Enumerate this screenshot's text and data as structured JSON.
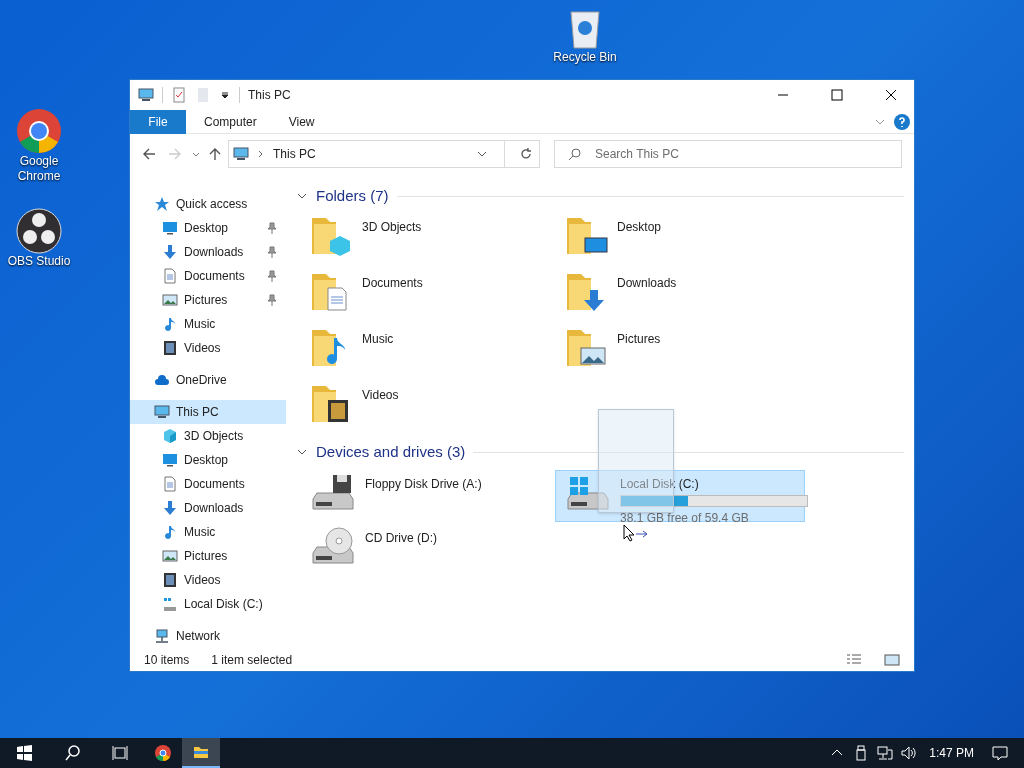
{
  "desktop_icons": [
    {
      "label": "Recycle Bin",
      "kind": "bin"
    },
    {
      "label": "Google Chrome",
      "kind": "chrome"
    },
    {
      "label": "OBS Studio",
      "kind": "obs"
    }
  ],
  "window": {
    "title": "This PC",
    "file_button": "File",
    "ribbon_tabs": [
      "Computer",
      "View"
    ],
    "address": "This PC",
    "search": {
      "placeholder": "Search This PC"
    }
  },
  "nav": [
    {
      "label": "Quick access",
      "kind": "star",
      "selected": false,
      "children": [
        {
          "label": "Desktop",
          "kind": "desktop",
          "pinned": true,
          "selected": false
        },
        {
          "label": "Downloads",
          "kind": "downloads",
          "pinned": true,
          "selected": false
        },
        {
          "label": "Documents",
          "kind": "documents",
          "pinned": true,
          "selected": false
        },
        {
          "label": "Pictures",
          "kind": "pictures",
          "pinned": true,
          "selected": false
        },
        {
          "label": "Music",
          "kind": "music",
          "pinned": false,
          "selected": false
        },
        {
          "label": "Videos",
          "kind": "videos",
          "pinned": false,
          "selected": false
        }
      ]
    },
    {
      "label": "OneDrive",
      "kind": "cloud",
      "selected": false
    },
    {
      "label": "This PC",
      "kind": "pc",
      "selected": true,
      "children": [
        {
          "label": "3D Objects",
          "kind": "objects",
          "selected": false
        },
        {
          "label": "Desktop",
          "kind": "desktop",
          "selected": false
        },
        {
          "label": "Documents",
          "kind": "documents",
          "selected": false
        },
        {
          "label": "Downloads",
          "kind": "downloads",
          "selected": false
        },
        {
          "label": "Music",
          "kind": "music",
          "selected": false
        },
        {
          "label": "Pictures",
          "kind": "pictures",
          "selected": false
        },
        {
          "label": "Videos",
          "kind": "videos",
          "selected": false
        },
        {
          "label": "Local Disk (C:)",
          "kind": "disk",
          "selected": false
        }
      ]
    },
    {
      "label": "Network",
      "kind": "network",
      "selected": false
    }
  ],
  "folders": {
    "title": "Folders (7)",
    "expanded": true,
    "items": [
      {
        "name": "3D Objects",
        "kind": "objects"
      },
      {
        "name": "Desktop",
        "kind": "desktop"
      },
      {
        "name": "Documents",
        "kind": "documents"
      },
      {
        "name": "Downloads",
        "kind": "downloads"
      },
      {
        "name": "Music",
        "kind": "music"
      },
      {
        "name": "Pictures",
        "kind": "pictures"
      },
      {
        "name": "Videos",
        "kind": "videos"
      }
    ]
  },
  "devices": {
    "title": "Devices and drives (3)",
    "expanded": true,
    "items": [
      {
        "name": "Floppy Disk Drive (A:)",
        "kind": "floppy",
        "selected": false
      },
      {
        "name": "Local Disk (C:)",
        "kind": "disk",
        "selected": true,
        "level": 0.36,
        "space": "38.1 GB free of 59.4 GB"
      },
      {
        "name": "CD Drive (D:)",
        "kind": "cd",
        "selected": false
      }
    ]
  },
  "status_bar": {
    "count": "10 items",
    "selection": "1 item selected"
  },
  "taskbar": {
    "apps": [
      {
        "kind": "chrome",
        "selected": false
      },
      {
        "kind": "explorer",
        "selected": true
      }
    ],
    "time": "1:47 PM"
  }
}
